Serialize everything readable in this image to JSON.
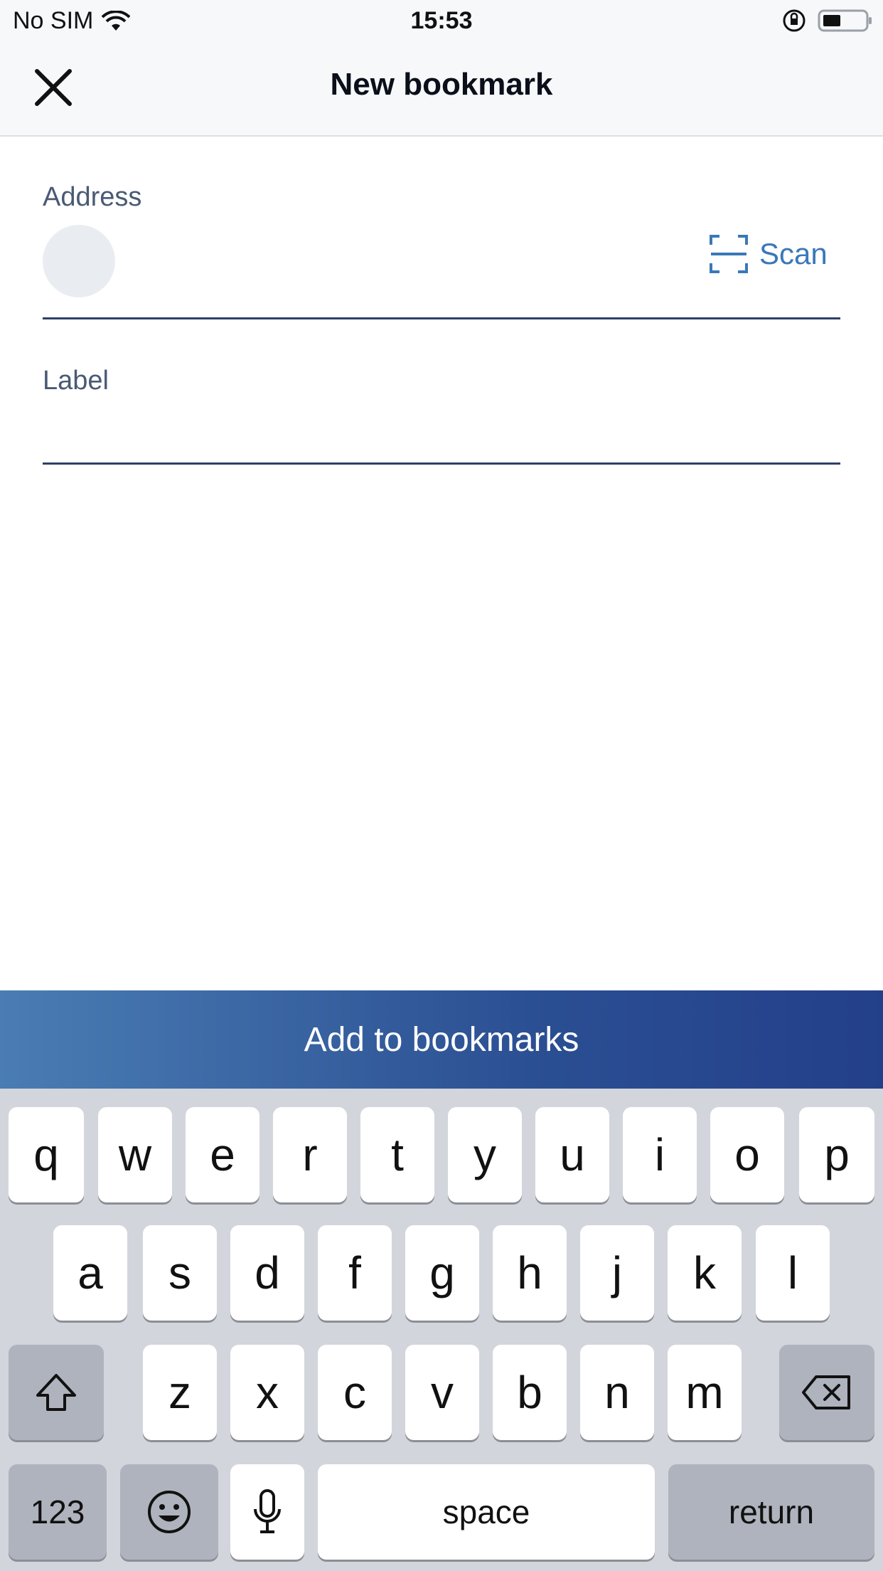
{
  "status_bar": {
    "carrier": "No SIM",
    "time": "15:53"
  },
  "nav": {
    "title": "New bookmark"
  },
  "form": {
    "address_label": "Address",
    "address_value": "",
    "scan_label": "Scan",
    "label_label": "Label",
    "label_value": ""
  },
  "cta": {
    "label": "Add to bookmarks"
  },
  "colors": {
    "accent": "#3a78b8",
    "cta_start": "#4a7db3",
    "cta_end": "#233f8a",
    "keyboard_bg": "#d2d5db"
  },
  "keyboard": {
    "row1": [
      "q",
      "w",
      "e",
      "r",
      "t",
      "y",
      "u",
      "i",
      "o",
      "p"
    ],
    "row2": [
      "a",
      "s",
      "d",
      "f",
      "g",
      "h",
      "j",
      "k",
      "l"
    ],
    "row3": [
      "z",
      "x",
      "c",
      "v",
      "b",
      "n",
      "m"
    ],
    "numbers_label": "123",
    "space_label": "space",
    "return_label": "return",
    "icons": [
      "shift-icon",
      "backspace-icon",
      "emoji-icon",
      "microphone-icon"
    ]
  }
}
